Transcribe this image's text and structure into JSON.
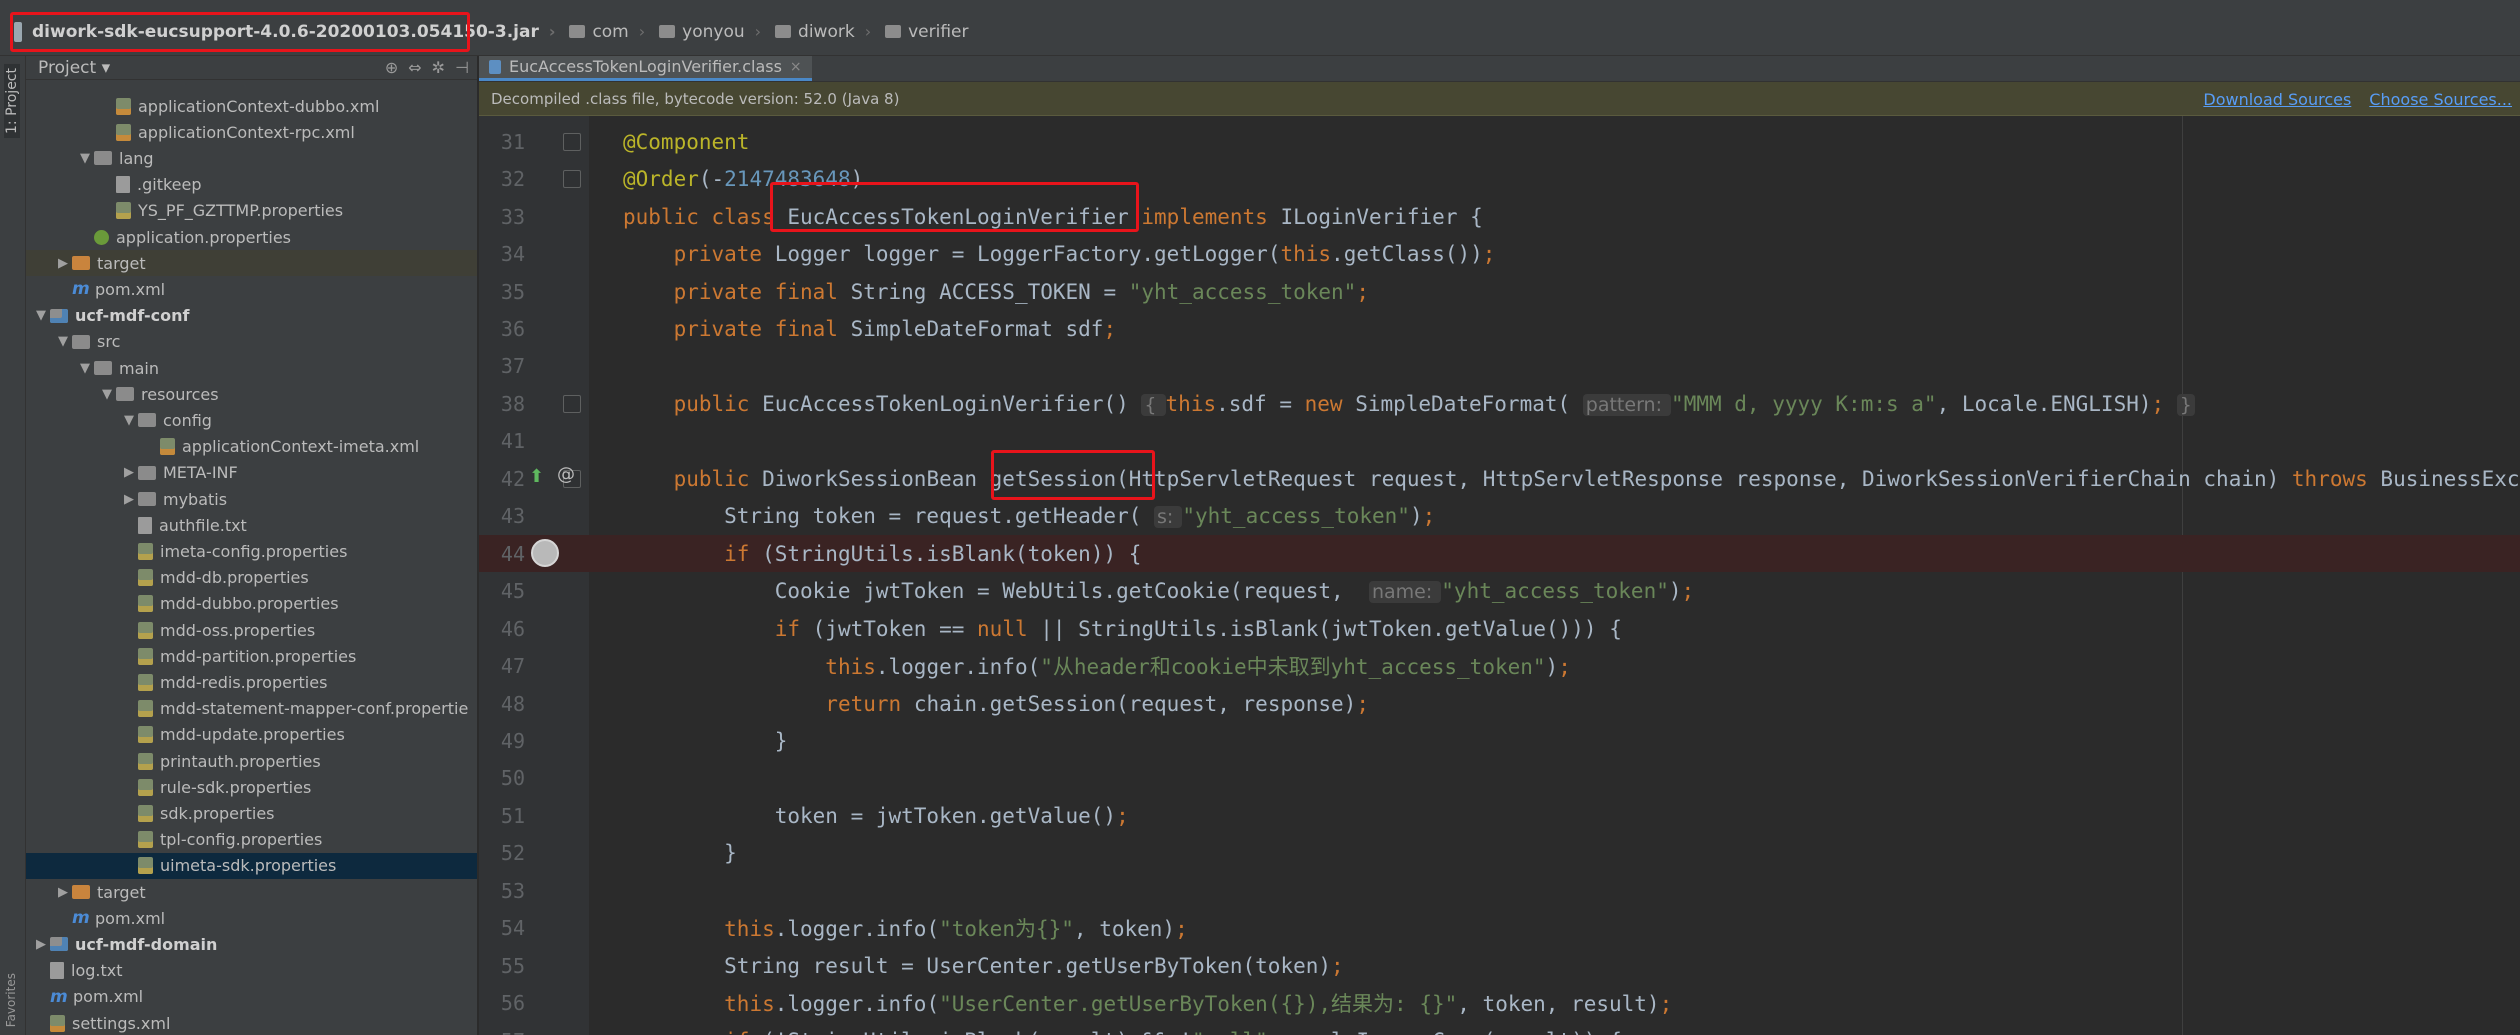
{
  "navbar": {
    "jar": "diwork-sdk-eucsupport-4.0.6-20200103.054150-3.jar",
    "crumbs": [
      "com",
      "yonyou",
      "diwork",
      "verifier"
    ]
  },
  "stripe": {
    "project": "1: Project",
    "favorites": "Favorites"
  },
  "project": {
    "title": "Project",
    "rows": [
      {
        "indent": 3,
        "arrow": "",
        "icon": "xml",
        "label": "applicationContext-dubbo.xml"
      },
      {
        "indent": 3,
        "arrow": "",
        "icon": "xml",
        "label": "applicationContext-rpc.xml"
      },
      {
        "indent": 2,
        "arrow": "▼",
        "icon": "folder",
        "label": "lang"
      },
      {
        "indent": 3,
        "arrow": "",
        "icon": "git",
        "label": ".gitkeep"
      },
      {
        "indent": 3,
        "arrow": "",
        "icon": "props",
        "label": "YS_PF_GZTTMP.properties"
      },
      {
        "indent": 2,
        "arrow": "",
        "icon": "spring",
        "label": "application.properties"
      },
      {
        "indent": 1,
        "arrow": "▶",
        "icon": "folder-orange",
        "label": "target",
        "cls": "target-row"
      },
      {
        "indent": 1,
        "arrow": "",
        "icon": "maven",
        "label": "pom.xml"
      },
      {
        "indent": 0,
        "arrow": "▼",
        "icon": "folder-mod",
        "label": "ucf-mdf-conf",
        "bold": true
      },
      {
        "indent": 1,
        "arrow": "▼",
        "icon": "folder",
        "label": "src"
      },
      {
        "indent": 2,
        "arrow": "▼",
        "icon": "folder",
        "label": "main"
      },
      {
        "indent": 3,
        "arrow": "▼",
        "icon": "folder",
        "label": "resources"
      },
      {
        "indent": 4,
        "arrow": "▼",
        "icon": "folder",
        "label": "config"
      },
      {
        "indent": 5,
        "arrow": "",
        "icon": "xml",
        "label": "applicationContext-imeta.xml"
      },
      {
        "indent": 4,
        "arrow": "▶",
        "icon": "folder",
        "label": "META-INF"
      },
      {
        "indent": 4,
        "arrow": "▶",
        "icon": "folder",
        "label": "mybatis"
      },
      {
        "indent": 4,
        "arrow": "",
        "icon": "text",
        "label": "authfile.txt"
      },
      {
        "indent": 4,
        "arrow": "",
        "icon": "props",
        "label": "imeta-config.properties"
      },
      {
        "indent": 4,
        "arrow": "",
        "icon": "props",
        "label": "mdd-db.properties"
      },
      {
        "indent": 4,
        "arrow": "",
        "icon": "props",
        "label": "mdd-dubbo.properties"
      },
      {
        "indent": 4,
        "arrow": "",
        "icon": "props",
        "label": "mdd-oss.properties"
      },
      {
        "indent": 4,
        "arrow": "",
        "icon": "props",
        "label": "mdd-partition.properties"
      },
      {
        "indent": 4,
        "arrow": "",
        "icon": "props",
        "label": "mdd-redis.properties"
      },
      {
        "indent": 4,
        "arrow": "",
        "icon": "props",
        "label": "mdd-statement-mapper-conf.propertie"
      },
      {
        "indent": 4,
        "arrow": "",
        "icon": "props",
        "label": "mdd-update.properties"
      },
      {
        "indent": 4,
        "arrow": "",
        "icon": "props",
        "label": "printauth.properties"
      },
      {
        "indent": 4,
        "arrow": "",
        "icon": "props",
        "label": "rule-sdk.properties"
      },
      {
        "indent": 4,
        "arrow": "",
        "icon": "props",
        "label": "sdk.properties"
      },
      {
        "indent": 4,
        "arrow": "",
        "icon": "props",
        "label": "tpl-config.properties"
      },
      {
        "indent": 4,
        "arrow": "",
        "icon": "props",
        "label": "uimeta-sdk.properties",
        "cls": "hl"
      },
      {
        "indent": 1,
        "arrow": "▶",
        "icon": "folder-orange",
        "label": "target"
      },
      {
        "indent": 1,
        "arrow": "",
        "icon": "maven",
        "label": "pom.xml"
      },
      {
        "indent": 0,
        "arrow": "▶",
        "icon": "folder-mod",
        "label": "ucf-mdf-domain",
        "bold": true
      },
      {
        "indent": 0,
        "arrow": "",
        "icon": "text",
        "label": "log.txt"
      },
      {
        "indent": 0,
        "arrow": "",
        "icon": "maven",
        "label": "pom.xml"
      },
      {
        "indent": 0,
        "arrow": "",
        "icon": "xml",
        "label": "settings.xml"
      }
    ]
  },
  "editor": {
    "tab": "EucAccessTokenLoginVerifier.class",
    "banner": "Decompiled .class file, bytecode version: 52.0 (Java 8)",
    "download_sources": "Download Sources",
    "choose_sources": "Choose Sources...",
    "lines": [
      {
        "n": "31",
        "html": "<span class='ann'>@Component</span>"
      },
      {
        "n": "32",
        "html": "<span class='ann'>@Order</span>(-<span class='num'>2147483648</span>)"
      },
      {
        "n": "33",
        "html": "<span class='kw'>public class </span>EucAccessTokenLoginVerifier <span class='kw'>implements </span>ILoginVerifier {"
      },
      {
        "n": "34",
        "html": "    <span class='kw'>private </span>Logger logger = LoggerFactory.getLogger(<span class='kw'>this</span>.getClass())<span class='kw'>;</span>"
      },
      {
        "n": "35",
        "html": "    <span class='kw'>private final </span>String ACCESS_TOKEN = <span class='str'>\"yht_access_token\"</span><span class='kw'>;</span>"
      },
      {
        "n": "36",
        "html": "    <span class='kw'>private final </span>SimpleDateFormat sdf<span class='kw'>;</span>"
      },
      {
        "n": "37",
        "html": ""
      },
      {
        "n": "38",
        "html": "    <span class='kw'>public </span>EucAccessTokenLoginVerifier() <span class='hint'>{ </span><span class='kw'>this</span>.sdf = <span class='kw'>new </span>SimpleDateFormat( <span class='hint'>pattern: </span><span class='str'>\"MMM d, yyyy K:m:s a\"</span>, Locale.ENGLISH)<span class='kw'>; </span><span class='hint'>}</span>"
      },
      {
        "n": "41",
        "html": ""
      },
      {
        "n": "42",
        "html": "    <span class='kw'>public </span>DiworkSessionBean getSession(HttpServletRequest request, HttpServletResponse response, DiworkSessionVerifierChain chain) <span class='kw'>throws </span>BusinessException {"
      },
      {
        "n": "43",
        "html": "        String token = request.getHeader( <span class='hint'>s: </span><span class='str'>\"yht_access_token\"</span>)<span class='kw'>;</span>"
      },
      {
        "n": "44",
        "html": "        <span class='kw'>if </span>(StringUtils.isBlank(token)) {",
        "bp": true
      },
      {
        "n": "45",
        "html": "            Cookie jwtToken = WebUtils.getCookie(request,  <span class='hint'>name: </span><span class='str'>\"yht_access_token\"</span>)<span class='kw'>;</span>"
      },
      {
        "n": "46",
        "html": "            <span class='kw'>if </span>(jwtToken == <span class='kw'>null </span>|| StringUtils.isBlank(jwtToken.getValue())) {"
      },
      {
        "n": "47",
        "html": "                <span class='kw'>this</span>.logger.info(<span class='str'>\"从header和cookie中未取到yht_access_token\"</span>)<span class='kw'>;</span>"
      },
      {
        "n": "48",
        "html": "                <span class='kw'>return </span>chain.getSession(request, response)<span class='kw'>;</span>"
      },
      {
        "n": "49",
        "html": "            }"
      },
      {
        "n": "50",
        "html": ""
      },
      {
        "n": "51",
        "html": "            token = jwtToken.getValue()<span class='kw'>;</span>"
      },
      {
        "n": "52",
        "html": "        }"
      },
      {
        "n": "53",
        "html": ""
      },
      {
        "n": "54",
        "html": "        <span class='kw'>this</span>.logger.info(<span class='str'>\"token为{}\"</span>, token)<span class='kw'>;</span>"
      },
      {
        "n": "55",
        "html": "        String result = UserCenter.getUserByToken(token)<span class='kw'>;</span>"
      },
      {
        "n": "56",
        "html": "        <span class='kw'>this</span>.logger.info(<span class='str'>\"UserCenter.getUserByToken({}),结果为: {}\"</span>, token, result)<span class='kw'>;</span>"
      },
      {
        "n": "57",
        "html": "        <span class='kw'>if </span>(!StringUtils.isBlank(result) &amp;&amp; !<span class='str'>\"null\"</span>.equalsIgnoreCase(result)) {"
      }
    ]
  }
}
